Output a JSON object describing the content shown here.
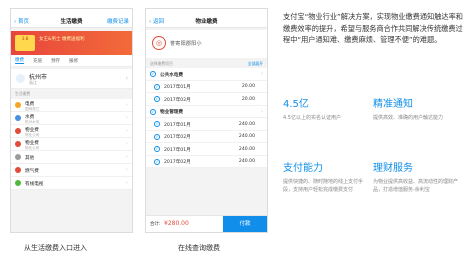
{
  "phone1": {
    "back": "‹ 首页",
    "title": "生活缴费",
    "right": "缴费记录",
    "banner": {
      "tag": "3.8",
      "line1": "女王&男士 缴费送福利",
      "line2": ""
    },
    "tabs": [
      "缴费",
      "充值",
      "预存",
      "报修"
    ],
    "city": {
      "name": "杭州市",
      "sub": "浙江"
    },
    "section": "生活缴费",
    "bills": [
      {
        "name": "电费",
        "sub": "国网浙江",
        "color": "#f5a623"
      },
      {
        "name": "水费",
        "sub": "杭州水务",
        "color": "#4a90e2"
      },
      {
        "name": "物业费",
        "sub": "物业公司",
        "color": "#e34b3a"
      },
      {
        "name": "物业费",
        "sub": "物业公司",
        "color": "#e34b3a"
      },
      {
        "name": "其他",
        "sub": "",
        "color": "#9b9b9b"
      },
      {
        "name": "燃气费",
        "sub": "",
        "color": "#e34b3a"
      },
      {
        "name": "有线电视",
        "sub": "",
        "color": "#50b83c"
      }
    ]
  },
  "phone2": {
    "back": "‹ 返回",
    "title": "物业缴费",
    "logo": "◎",
    "payee": "誉寄阳郡阳小",
    "head_left": "选择缴费项目",
    "head_right": "全部展开",
    "items": [
      {
        "name": "公共水电费",
        "amount": "",
        "group": true,
        "sub": false,
        "arrow": "›"
      },
      {
        "name": "2017年01月",
        "amount": "20.00",
        "group": false,
        "sub": true,
        "arrow": ""
      },
      {
        "name": "2017年02月",
        "amount": "20.00",
        "group": false,
        "sub": true,
        "arrow": ""
      },
      {
        "name": "物业管理费",
        "amount": "",
        "group": true,
        "sub": false,
        "arrow": "›"
      },
      {
        "name": "2017年01月",
        "amount": "240.00",
        "group": false,
        "sub": true,
        "arrow": ""
      },
      {
        "name": "2017年02月",
        "amount": "240.00",
        "group": false,
        "sub": true,
        "arrow": ""
      },
      {
        "name": "2017年01月",
        "amount": "240.00",
        "group": false,
        "sub": true,
        "arrow": ""
      },
      {
        "name": "2017年02月",
        "amount": "240.00",
        "group": false,
        "sub": true,
        "arrow": ""
      }
    ],
    "total_label": "合计:",
    "total": "¥280.00",
    "pay_button": "付款"
  },
  "captions": [
    "从生活缴费入口进入",
    "在线查询缴费"
  ],
  "description": "支付宝“物业行业”解决方案，实现物业缴费通知触达率和缴费效率的提升，希望与服务商合作共同解决传统缴费过程中“用户通知难、缴费麻烦、管理不便”的难题。",
  "features": [
    {
      "title": "4.5亿",
      "body": "4.5亿以上的实名认证用户"
    },
    {
      "title": "精准通知",
      "body": "提供高效、准确的用户触达能力"
    },
    {
      "title": "支付能力",
      "body": "提供快捷的、随时随地的线上支付手段，支持用户轻松完成缴费支付"
    },
    {
      "title": "理财服务",
      "body": "为物业提供高收益、高流动性的理财产品，打造增值服务-余利宝"
    }
  ],
  "accent": "#108ee9"
}
